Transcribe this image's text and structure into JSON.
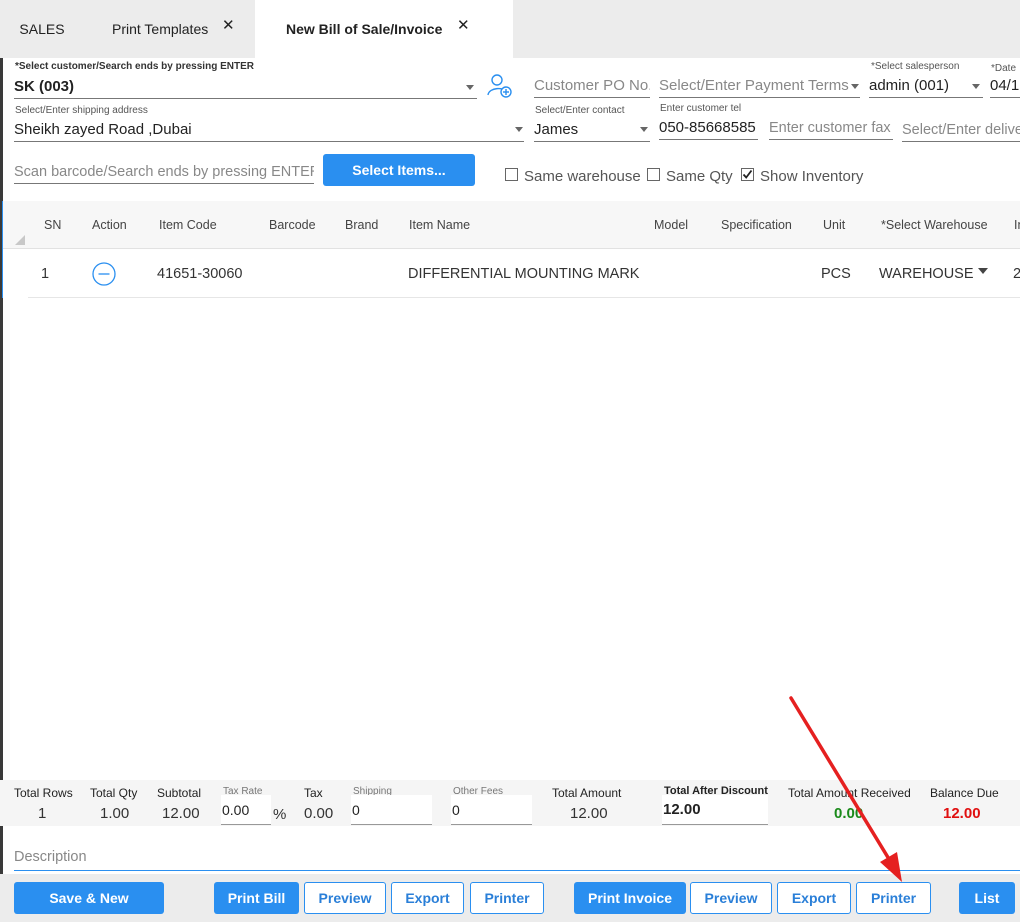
{
  "tabs": [
    {
      "label": "SALES"
    },
    {
      "label": "Print Templates"
    },
    {
      "label": "New Bill of Sale/Invoice"
    }
  ],
  "tab_close_glyph": "✕",
  "form": {
    "customer": {
      "label": "*Select customer/Search ends by pressing ENTER",
      "value": "SK (003)"
    },
    "customer_po": {
      "placeholder": "Customer PO No."
    },
    "payment_terms": {
      "placeholder": "Select/Enter Payment Terms"
    },
    "salesperson": {
      "label": "*Select salesperson",
      "value": "admin (001)"
    },
    "date": {
      "label": "*Date",
      "value": "04/1"
    },
    "shipping": {
      "label": "Select/Enter shipping address",
      "value": "Sheikh zayed Road ,Dubai"
    },
    "contact": {
      "label": "Select/Enter contact",
      "value": "James"
    },
    "tel": {
      "label": "Enter customer tel",
      "value": "050-85668585"
    },
    "fax": {
      "placeholder": "Enter customer fax"
    },
    "delivery": {
      "placeholder": "Select/Enter delive"
    },
    "barcode": {
      "placeholder": "Scan barcode/Search ends by pressing ENTER"
    },
    "select_items_label": "Select Items...",
    "same_warehouse": {
      "label": "Same warehouse",
      "checked": false
    },
    "same_qty": {
      "label": "Same Qty",
      "checked": false
    },
    "show_inventory": {
      "label": "Show Inventory",
      "checked": true
    }
  },
  "table": {
    "columns": [
      "SN",
      "Action",
      "Item Code",
      "Barcode",
      "Brand",
      "Item Name",
      "Model",
      "Specification",
      "Unit",
      "*Select Warehouse",
      "In"
    ],
    "rows": [
      {
        "sn": "1",
        "item_code": "41651-30060",
        "barcode": "",
        "brand": "",
        "item_name": "DIFFERENTIAL MOUNTING MARK",
        "model": "",
        "spec": "",
        "unit": "PCS",
        "warehouse": "WAREHOUSE",
        "inv": "2"
      }
    ]
  },
  "totals": {
    "total_rows": {
      "label": "Total Rows",
      "value": "1"
    },
    "total_qty": {
      "label": "Total Qty",
      "value": "1.00"
    },
    "subtotal": {
      "label": "Subtotal",
      "value": "12.00"
    },
    "tax_rate": {
      "label": "Tax Rate",
      "value": "0.00",
      "unit": "%"
    },
    "tax": {
      "label": "Tax",
      "value": "0.00"
    },
    "shipping": {
      "label": "Shipping",
      "value": "0"
    },
    "other_fees": {
      "label": "Other Fees",
      "value": "0"
    },
    "total_amount": {
      "label": "Total Amount",
      "value": "12.00"
    },
    "total_after_discount": {
      "label": "Total After Discount",
      "value": "12.00"
    },
    "total_received": {
      "label": "Total Amount Received",
      "value": "0.00"
    },
    "balance_due": {
      "label": "Balance Due",
      "value": "12.00"
    }
  },
  "description": {
    "placeholder": "Description"
  },
  "buttons": {
    "save_new": "Save & New",
    "print_bill": "Print Bill",
    "preview1": "Preview",
    "export1": "Export",
    "printer1": "Printer",
    "print_invoice": "Print Invoice",
    "preview2": "Preview",
    "export2": "Export",
    "printer2": "Printer",
    "list": "List"
  },
  "colors": {
    "accent": "#2a8ff0",
    "received": "#1a8a1a",
    "balance_due": "#e01010",
    "annotation_arrow": "#e52020"
  },
  "icons": {
    "add_contact": "add-person-icon",
    "remove_row": "minus-circle-icon",
    "arrow": "red-annotation-arrow"
  }
}
